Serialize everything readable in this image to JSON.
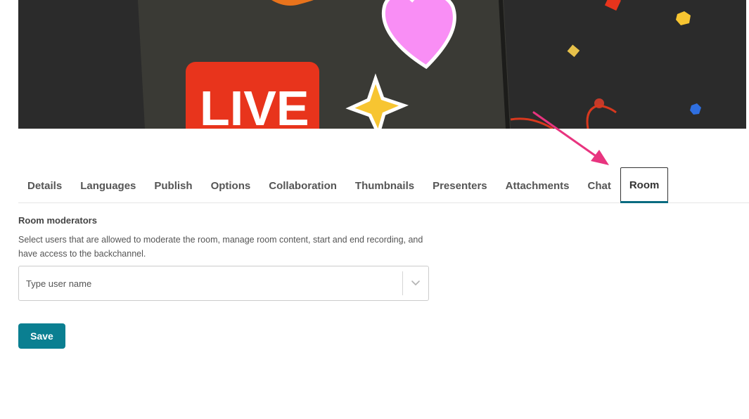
{
  "hero": {
    "badge_text": "LIVE",
    "colors": {
      "background": "#2b2b2b",
      "phone": "#3a3a35",
      "badge": "#e8341c",
      "heart": "#f98ef5",
      "star": "#f7c531"
    }
  },
  "tabs": [
    {
      "label": "Details",
      "active": false
    },
    {
      "label": "Languages",
      "active": false
    },
    {
      "label": "Publish",
      "active": false
    },
    {
      "label": "Options",
      "active": false
    },
    {
      "label": "Collaboration",
      "active": false
    },
    {
      "label": "Thumbnails",
      "active": false
    },
    {
      "label": "Presenters",
      "active": false
    },
    {
      "label": "Attachments",
      "active": false
    },
    {
      "label": "Chat",
      "active": false
    },
    {
      "label": "Room",
      "active": true
    }
  ],
  "room": {
    "title": "Room moderators",
    "description": "Select users that are allowed to moderate the room, manage room content, start and end recording, and have access to the backchannel.",
    "user_select": {
      "placeholder": "Type user name",
      "value": ""
    }
  },
  "actions": {
    "save_label": "Save"
  },
  "colors": {
    "accent": "#0a7f91",
    "active_tab_underline": "#0a6b80",
    "annotation_arrow": "#e8347f"
  }
}
